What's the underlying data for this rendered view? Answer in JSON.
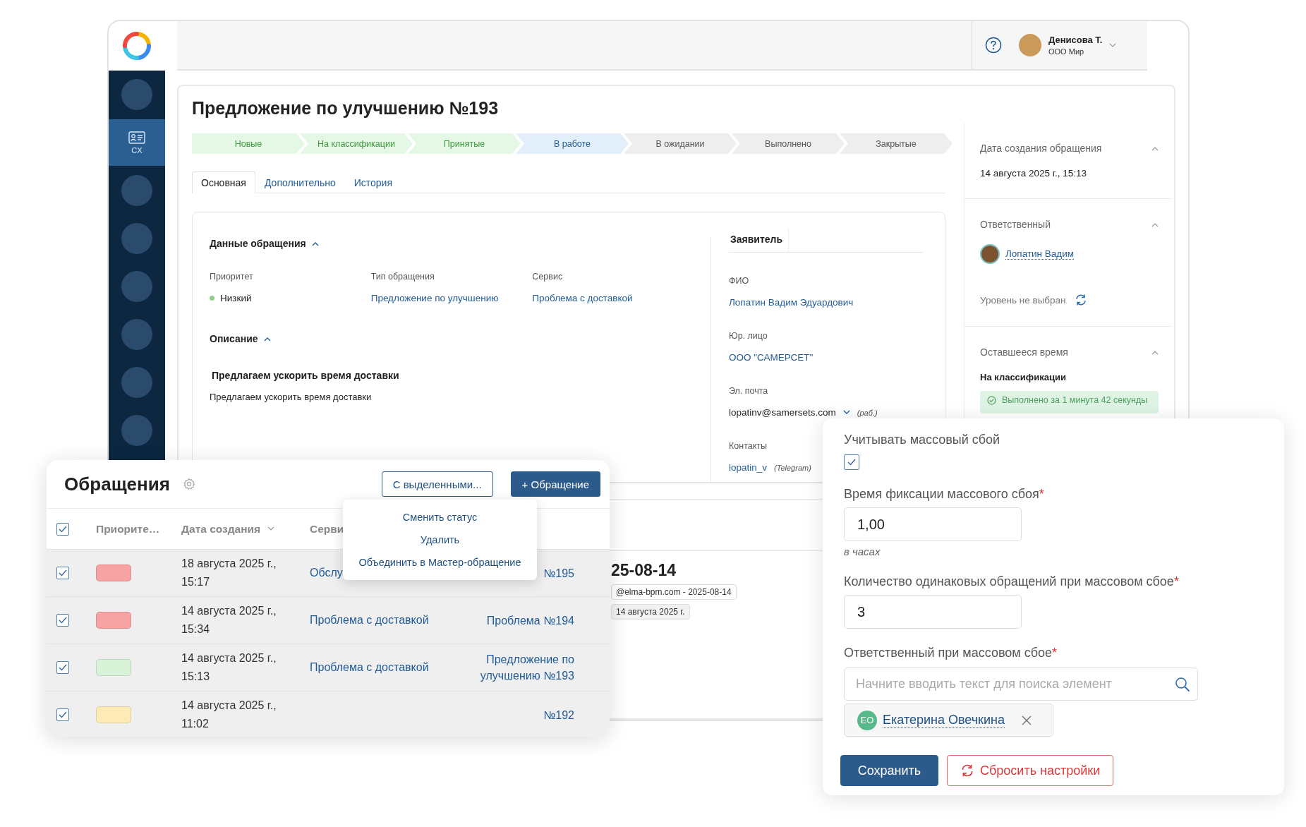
{
  "sidebar": {
    "items": [
      {
        "kind": "placeholder",
        "selected": false
      },
      {
        "kind": "module",
        "label": "CX",
        "selected": true
      },
      {
        "kind": "placeholder",
        "selected": false
      },
      {
        "kind": "placeholder",
        "selected": false
      },
      {
        "kind": "placeholder",
        "selected": false
      },
      {
        "kind": "placeholder",
        "selected": false
      },
      {
        "kind": "placeholder",
        "selected": false
      },
      {
        "kind": "placeholder",
        "selected": false
      }
    ]
  },
  "topbar": {
    "user": {
      "name": "Денисова Т.",
      "company": "ООО Мир"
    }
  },
  "record": {
    "title": "Предложение по улучшению №193",
    "stages": [
      {
        "label": "Новые",
        "completed": true,
        "selected": false
      },
      {
        "label": "На классификации",
        "completed": true,
        "selected": false
      },
      {
        "label": "Принятые",
        "completed": true,
        "selected": false
      },
      {
        "label": "В работе",
        "completed": false,
        "selected": true
      },
      {
        "label": "В ожидании",
        "completed": false,
        "selected": false
      },
      {
        "label": "Выполнено",
        "completed": false,
        "selected": false
      },
      {
        "label": "Закрытые",
        "completed": false,
        "selected": false
      }
    ],
    "tabs": [
      {
        "label": "Основная",
        "selected": true
      },
      {
        "label": "Дополнительно",
        "selected": false
      },
      {
        "label": "История",
        "selected": false
      }
    ],
    "details": {
      "heading": "Данные обращения",
      "expanded": true,
      "fields": [
        {
          "label": "Приоритет",
          "value": "Низкий",
          "kind": "priority",
          "color": "#8fd08f"
        },
        {
          "label": "Тип обращения",
          "value": "Предложение по улучшению",
          "kind": "link"
        },
        {
          "label": "Сервис",
          "value": "Проблема с доставкой",
          "kind": "link"
        }
      ]
    },
    "description": {
      "heading": "Описание",
      "expanded": true,
      "subject": "Предлагаем ускорить время доставки",
      "text": "Предлагаем ускорить время доставки"
    },
    "applicant": {
      "heading": "Заявитель",
      "fields": [
        {
          "label": "ФИО",
          "value": "Лопатин Вадим Эдуардович",
          "kind": "link"
        },
        {
          "label": "Юр. лицо",
          "value": "ООО \"САМЕРСЕТ\"",
          "kind": "link"
        },
        {
          "label": "Эл. почта",
          "value": "lopatinv@samersets.com",
          "note": "(раб.)",
          "kind": "email"
        },
        {
          "label": "Контакты",
          "value": "lopatin_v",
          "note": "(Telegram)",
          "kind": "link"
        }
      ]
    },
    "activity": {
      "heading": "25-08-14",
      "chips": [
        "@elma-bpm.com - 2025-08-14",
        "14 августа 2025 г."
      ]
    },
    "side_panel": {
      "sections": [
        {
          "kind": "date",
          "heading": "Дата создания обращения",
          "expanded": true,
          "value": "14 августа 2025 г., 15:13"
        },
        {
          "kind": "assignee",
          "heading": "Ответственный",
          "expanded": true,
          "user": "Лопатин Вадим",
          "tier_label": "Уровень не выбран"
        },
        {
          "kind": "timer",
          "heading": "Оставшееся время",
          "expanded": true,
          "stage": "На классификации",
          "status": "Выполнено за 1 минута 42 секунды"
        }
      ]
    }
  },
  "list_window": {
    "title": "Обращения",
    "buttons": [
      {
        "label": "С выделенными...",
        "kind": "outline"
      },
      {
        "label": "+ Обращение",
        "kind": "primary"
      }
    ],
    "select_all_checked": true,
    "columns": [
      {
        "label": "Приорите…"
      },
      {
        "label": "Дата создания",
        "sorted": true
      },
      {
        "label": "Серви"
      }
    ],
    "rows": [
      {
        "checked": true,
        "color": "#f7a3a3",
        "date": "18 августа 2025 г., 15:17",
        "service": "Обслу",
        "number": "№195"
      },
      {
        "checked": true,
        "color": "#f7a3a3",
        "date": "14 августа 2025 г., 15:34",
        "service": "Проблема с доставкой",
        "number": "Проблема №194"
      },
      {
        "checked": true,
        "color": "#d9f3d9",
        "date": "14 августа 2025 г., 15:13",
        "service": "Проблема с доставкой",
        "number": "Предложение по улучшению №193"
      },
      {
        "checked": true,
        "color": "#fdeab5",
        "date": "14 августа 2025 г., 11:02",
        "number": "№192"
      }
    ],
    "menu": {
      "items": [
        "Сменить статус",
        "Удалить",
        "Объединить в Мастер-обращение"
      ]
    }
  },
  "mass_outage": {
    "fields": [
      {
        "kind": "checkbox",
        "label": "Учитывать массовый сбой",
        "checked": true
      },
      {
        "kind": "number",
        "label": "Время фиксации массового сбоя",
        "required_mark": "*",
        "value": "1,00",
        "hint": "в часах"
      },
      {
        "kind": "number",
        "label": "Количество одинаковых обращений при массовом сбое",
        "required_mark": "*",
        "value": "3"
      },
      {
        "kind": "user_search",
        "label": "Ответственный при массовом сбое",
        "required_mark": "*",
        "placeholder": "Начните вводить текст для поиска элемент",
        "selected_users": [
          {
            "initials": "ЕО",
            "name": "Екатерина Овечкина"
          }
        ]
      }
    ],
    "buttons": [
      {
        "label": "Сохранить",
        "kind": "primary"
      },
      {
        "label": "Сбросить настройки",
        "kind": "danger"
      }
    ]
  }
}
